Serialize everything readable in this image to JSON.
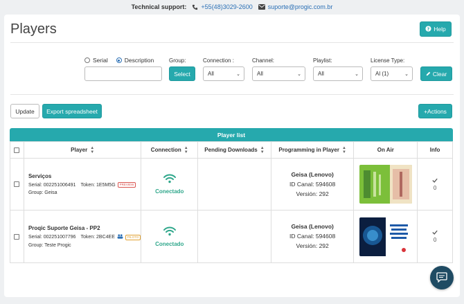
{
  "topbar": {
    "label": "Technical support:",
    "phone": "+55(48)3029-2600",
    "email": "suporte@progic.com.br"
  },
  "page": {
    "title": "Players",
    "help_label": "Help"
  },
  "filters": {
    "radio_serial": "Serial",
    "radio_description": "Description",
    "group_label": "Group:",
    "select_button": "Select",
    "connection_label": "Connection :",
    "connection_value": "All",
    "channel_label": "Channel:",
    "channel_value": "All",
    "playlist_label": "Playlist:",
    "playlist_value": "All",
    "license_label": "License Type:",
    "license_value": "Al (1)",
    "clear_label": "Clear"
  },
  "toolbar": {
    "update_label": "Update",
    "export_label": "Export spreadsheet",
    "actions_label": "+Actions"
  },
  "table": {
    "title": "Player list",
    "headers": {
      "player": "Player",
      "connection": "Connection",
      "pending": "Pending Downloads",
      "programming": "Programming in Player",
      "onair": "On Air",
      "info": "Info"
    },
    "rows": [
      {
        "name": "Serviços",
        "serial": "Serial: 002251006491",
        "token": "Token: 1E5M5G",
        "tag": "PREVIEW",
        "group": "Group: Geisa",
        "connection": "Conectado",
        "prog_name": "Geisa (Lenovo)",
        "prog_channel": "ID Canal: 594608",
        "prog_version": "Versión: 292",
        "info_count": "0"
      },
      {
        "name": "Proqic Suporte Geisa - PP2",
        "serial": "Serial: 002251007796",
        "token": "Token: 2BC4EE",
        "tag": "PILOTO",
        "group": "Group: Teste Progic",
        "connection": "Conectado",
        "prog_name": "Geisa (Lenovo)",
        "prog_channel": "ID Canal: 594608",
        "prog_version": "Versión: 292",
        "info_count": "0"
      }
    ]
  },
  "colors": {
    "accent": "#26a9ad",
    "connected": "#2fa78b",
    "chat": "#1f4b63"
  }
}
